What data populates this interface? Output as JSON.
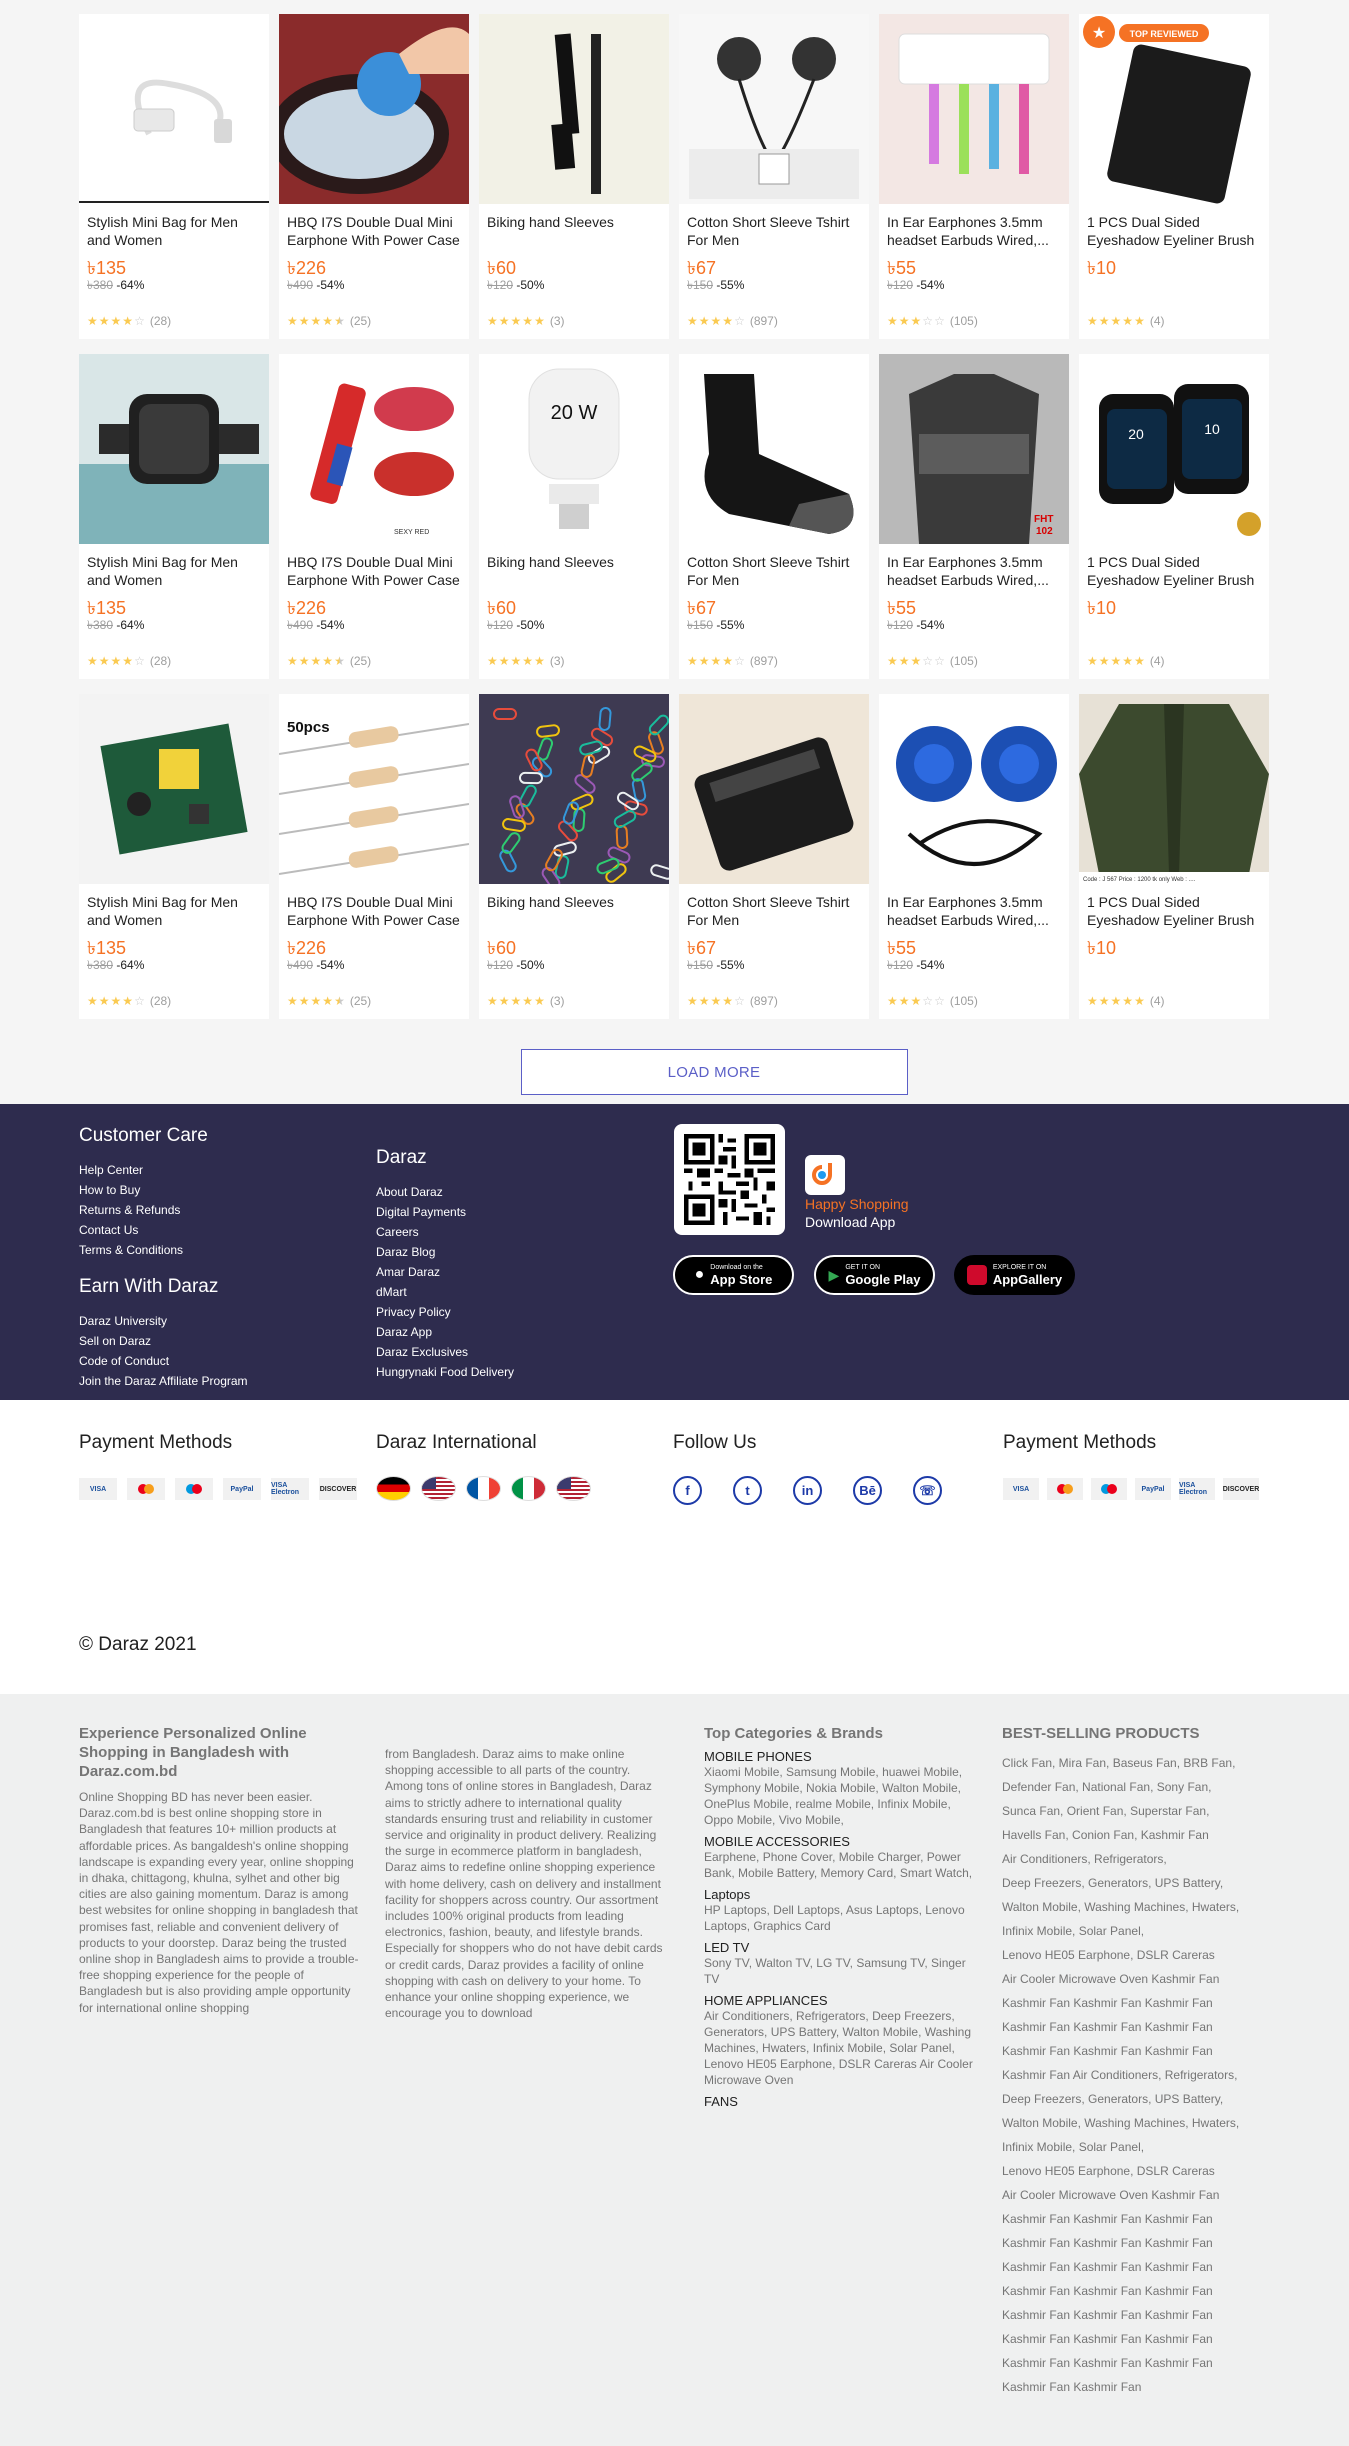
{
  "products": [
    {
      "title": "Stylish Mini Bag for Men and Women",
      "price": "৳135",
      "original": "৳380",
      "discount": "-64%",
      "stars": 4,
      "half": false,
      "reviews": "(28)",
      "img": "otg"
    },
    {
      "title": "HBQ I7S Double Dual Mini Earphone With Power Case",
      "price": "৳226",
      "original": "৳490",
      "discount": "-54%",
      "stars": 4,
      "half": true,
      "reviews": "(25)",
      "img": "brush"
    },
    {
      "title": "Biking hand Sleeves",
      "price": "৳60",
      "original": "৳120",
      "discount": "-50%",
      "stars": 5,
      "half": false,
      "reviews": "(3)",
      "img": "marker"
    },
    {
      "title": "Cotton Short Sleeve Tshirt For Men",
      "price": "৳67",
      "original": "৳150",
      "discount": "-55%",
      "stars": 4,
      "half": false,
      "reviews": "(897)",
      "img": "earphone"
    },
    {
      "title": "In Ear Earphones 3.5mm headset Earbuds Wired,...",
      "price": "৳55",
      "original": "৳120",
      "discount": "-54%",
      "stars": 3,
      "half": false,
      "reviews": "(105)",
      "img": "toothbrush"
    },
    {
      "title": "1 PCS Dual Sided Eyeshadow Eyeliner Brush",
      "price": "৳10",
      "original": "",
      "discount": "",
      "stars": 5,
      "half": false,
      "reviews": "(4)",
      "img": "wallet"
    },
    {
      "title": "Stylish Mini Bag for Men and Women",
      "price": "৳135",
      "original": "৳380",
      "discount": "-64%",
      "stars": 4,
      "half": false,
      "reviews": "(28)",
      "img": "watch"
    },
    {
      "title": "HBQ I7S Double Dual Mini Earphone With Power Case",
      "price": "৳226",
      "original": "৳490",
      "discount": "-54%",
      "stars": 4,
      "half": true,
      "reviews": "(25)",
      "img": "lips"
    },
    {
      "title": "Biking hand Sleeves",
      "price": "৳60",
      "original": "৳120",
      "discount": "-50%",
      "stars": 5,
      "half": false,
      "reviews": "(3)",
      "img": "bulb"
    },
    {
      "title": "Cotton Short Sleeve Tshirt For Men",
      "price": "৳67",
      "original": "৳150",
      "discount": "-55%",
      "stars": 4,
      "half": false,
      "reviews": "(897)",
      "img": "sock"
    },
    {
      "title": "In Ear Earphones 3.5mm headset Earbuds Wired,...",
      "price": "৳55",
      "original": "৳120",
      "discount": "-54%",
      "stars": 3,
      "half": false,
      "reviews": "(105)",
      "img": "polo"
    },
    {
      "title": "1 PCS Dual Sided Eyeshadow Eyeliner Brush",
      "price": "৳10",
      "original": "",
      "discount": "",
      "stars": 5,
      "half": false,
      "reviews": "(4)",
      "img": "smartwatch"
    },
    {
      "title": "Stylish Mini Bag for Men and Women",
      "price": "৳135",
      "original": "৳380",
      "discount": "-64%",
      "stars": 4,
      "half": false,
      "reviews": "(28)",
      "img": "pcb"
    },
    {
      "title": "HBQ I7S Double Dual Mini Earphone With Power Case",
      "price": "৳226",
      "original": "৳490",
      "discount": "-54%",
      "stars": 4,
      "half": true,
      "reviews": "(25)",
      "img": "resistor"
    },
    {
      "title": "Biking hand Sleeves",
      "price": "৳60",
      "original": "৳120",
      "discount": "-50%",
      "stars": 5,
      "half": false,
      "reviews": "(3)",
      "img": "clips"
    },
    {
      "title": "Cotton Short Sleeve Tshirt For Men",
      "price": "৳67",
      "original": "৳150",
      "discount": "-55%",
      "stars": 4,
      "half": false,
      "reviews": "(897)",
      "img": "wallet2"
    },
    {
      "title": "In Ear Earphones 3.5mm headset Earbuds Wired,...",
      "price": "৳55",
      "original": "৳120",
      "discount": "-54%",
      "stars": 3,
      "half": false,
      "reviews": "(105)",
      "img": "headphone"
    },
    {
      "title": "1 PCS Dual Sided Eyeshadow Eyeliner Brush",
      "price": "৳10",
      "original": "",
      "discount": "",
      "stars": 5,
      "half": false,
      "reviews": "(4)",
      "img": "jacket"
    }
  ],
  "image_text": {
    "top_reviewed": "TOP REVIEWED",
    "bulb_label": "20 W",
    "resistor_label": "50pcs",
    "polo_label": "FHT 102",
    "lips_label": "SEXY RED",
    "jacket_label": "Code : J 567   Price : 1200 tk only   Web : ...."
  },
  "load_more": "LOAD MORE",
  "footer": {
    "customer_care": {
      "title": "Customer Care",
      "links": [
        "Help Center",
        "How to Buy",
        "Returns & Refunds",
        "Contact Us",
        "Terms & Conditions"
      ]
    },
    "earn": {
      "title": "Earn With Daraz",
      "links": [
        "Daraz University",
        "Sell on Daraz",
        "Code of Conduct",
        "Join the Daraz Affiliate Program"
      ]
    },
    "daraz": {
      "title": "Daraz",
      "links": [
        "About Daraz",
        "Digital Payments",
        "Careers",
        "Daraz Blog",
        "Amar Daraz",
        "dMart",
        "Privacy Policy",
        "Daraz App",
        "Daraz Exclusives",
        "Hungrynaki Food Delivery"
      ]
    },
    "happy": "Happy Shopping",
    "download": "Download App",
    "stores": [
      {
        "small": "Download on the",
        "big": "App Store"
      },
      {
        "small": "GET IT ON",
        "big": "Google Play"
      },
      {
        "small": "EXPLORE IT ON",
        "big": "AppGallery"
      }
    ]
  },
  "payment": {
    "title": "Payment Methods",
    "cards": [
      "VISA",
      "MC",
      "Maestro",
      "PayPal",
      "VISA Electron",
      "DISCOVER"
    ]
  },
  "international": {
    "title": "Daraz International"
  },
  "follow": {
    "title": "Follow Us",
    "icons": [
      "f",
      "t",
      "in",
      "Bē",
      "☏"
    ]
  },
  "payment2": {
    "title": "Payment Methods"
  },
  "copyright": "© Daraz 2021",
  "seo": {
    "heading": "Experience Personalized Online Shopping in Bangladesh with Daraz.com.bd",
    "p1": "Online Shopping BD has never been easier. Daraz.com.bd is best online shopping store in Bangladesh that features 10+ million products at affordable prices. As bangaldesh's online shopping landscape is expanding every year, online shopping in dhaka, chittagong, khulna, sylhet and other big cities are also gaining momentum. Daraz is among best websites for online shopping in bangladesh that promises fast, reliable and convenient delivery of products to your doorstep. Daraz being the trusted online shop in Bangladesh aims to provide a trouble-free shopping experience for the people of Bangladesh but is also providing ample opportunity for international online shopping",
    "p2": "from Bangladesh. Daraz aims to make online shopping accessible to all parts of the country. Among tons of online stores in Bangladesh, Daraz aims to strictly adhere to international quality standards ensuring trust and reliability in customer service and originality in product delivery. Realizing the surge in ecommerce platform in bangladesh, Daraz aims to redefine online shopping experience with home delivery, cash on delivery and installment facility for shoppers across country. Our assortment includes 100% original products from leading electronics, fashion, beauty, and lifestyle brands. Especially for shoppers who do not have debit cards or credit cards, Daraz provides a facility of online shopping with cash on delivery to your home. To enhance your online shopping experience, we encourage you to download",
    "cat_title": "Top Categories & Brands",
    "categories": [
      {
        "name": "MOBILE PHONES",
        "items": "Xiaomi Mobile, Samsung Mobile, huawei Mobile, Symphony Mobile, Nokia Mobile, Walton Mobile, OnePlus Mobile, realme Mobile, Infinix Mobile, Oppo Mobile, Vivo Mobile,"
      },
      {
        "name": "MOBILE ACCESSORIES",
        "items": "Earphene, Phone Cover, Mobile Charger, Power Bank, Mobile Battery, Memory Card, Smart Watch,"
      },
      {
        "name": "Laptops",
        "items": "HP Laptops, Dell Laptops, Asus Laptops, Lenovo Laptops, Graphics Card"
      },
      {
        "name": "LED TV",
        "items": "Sony TV, Walton TV, LG TV, Samsung TV, Singer TV"
      },
      {
        "name": "HOME APPLIANCES",
        "items": "Air Conditioners, Refrigerators, Deep Freezers, Generators, UPS Battery, Walton Mobile, Washing Machines, Hwaters, Infinix Mobile, Solar Panel, Lenovo HE05 Earphone, DSLR Careras Air Cooler Microwave Oven"
      },
      {
        "name": "FANS",
        "items": ""
      }
    ],
    "best_title": "BEST-SELLING PRODUCTS",
    "best_lines": [
      "Click Fan, Mira Fan, Baseus Fan, BRB Fan,",
      "Defender Fan, National Fan, Sony Fan,",
      "Sunca Fan, Orient Fan, Superstar Fan,",
      "Havells Fan, Conion Fan, Kashmir Fan",
      "Air Conditioners, Refrigerators,",
      "Deep Freezers, Generators, UPS Battery,",
      "Walton Mobile, Washing Machines, Hwaters,",
      "Infinix Mobile, Solar Panel,",
      "Lenovo HE05 Earphone, DSLR Careras",
      "Air Cooler Microwave Oven Kashmir Fan",
      "Kashmir Fan Kashmir Fan Kashmir Fan",
      "Kashmir Fan Kashmir Fan Kashmir Fan",
      "Kashmir Fan Kashmir Fan Kashmir Fan",
      "Kashmir Fan Air Conditioners, Refrigerators,",
      "Deep Freezers, Generators, UPS Battery,",
      "Walton Mobile, Washing Machines, Hwaters,",
      "Infinix Mobile, Solar Panel,",
      "Lenovo HE05 Earphone, DSLR Careras",
      "Air Cooler Microwave Oven Kashmir Fan",
      "Kashmir Fan Kashmir Fan Kashmir Fan",
      "Kashmir Fan Kashmir Fan Kashmir Fan",
      "Kashmir Fan Kashmir Fan Kashmir Fan",
      "Kashmir Fan Kashmir Fan Kashmir Fan",
      "Kashmir Fan Kashmir Fan Kashmir Fan",
      "Kashmir Fan Kashmir Fan Kashmir Fan",
      "Kashmir Fan Kashmir Fan Kashmir Fan",
      "Kashmir Fan Kashmir Fan"
    ]
  }
}
